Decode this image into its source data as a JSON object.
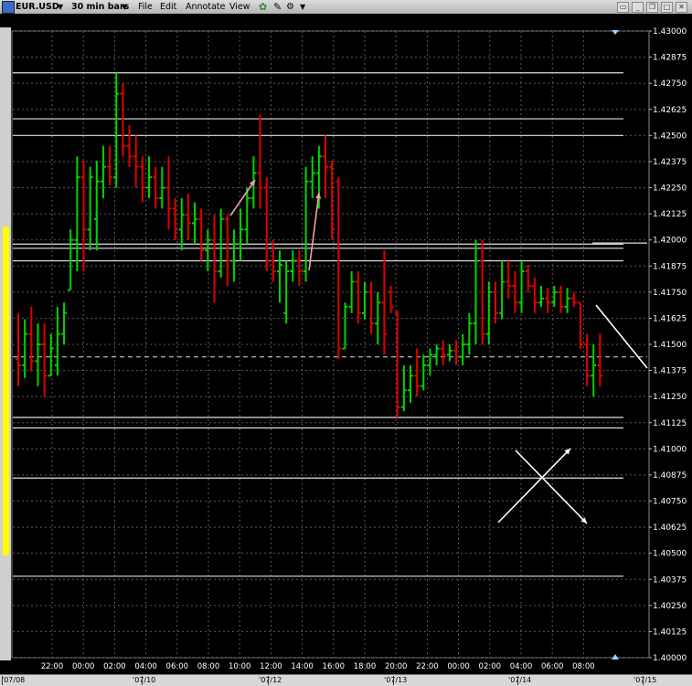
{
  "toolbar": {
    "symbol": "EUR.USD",
    "bar_size": "30 min bars",
    "menu": [
      "File",
      "Edit",
      "Annotate",
      "View"
    ]
  },
  "chart_data": {
    "type": "candlestick",
    "y_ticks": [
      "1.43000",
      "1.42875",
      "1.42750",
      "1.42625",
      "1.42500",
      "1.42375",
      "1.42250",
      "1.42125",
      "1.42000",
      "1.41875",
      "1.41750",
      "1.41625",
      "1.41500",
      "1.41375",
      "1.41250",
      "1.41125",
      "1.41000",
      "1.40875",
      "1.40750",
      "1.40625",
      "1.40500",
      "1.40375",
      "1.40250",
      "1.40125",
      "1.40000"
    ],
    "ylim": [
      1.4,
      1.43
    ],
    "time_ticks": [
      "22:00",
      "00:00",
      "02:00",
      "04:00",
      "06:00",
      "08:00",
      "10:00",
      "12:00",
      "14:00",
      "16:00",
      "18:00",
      "20:00",
      "22:00",
      "00:00",
      "02:00",
      "04:00",
      "06:00",
      "08:00"
    ],
    "date_ticks": [
      "'07/08",
      "'07/10",
      "'07/12",
      "'07/13",
      "'07/14",
      "'07/15"
    ],
    "grid": true,
    "horizontal_lines": [
      1.428,
      1.4258,
      1.425,
      1.4198,
      1.4196,
      1.419,
      1.4115,
      1.411,
      1.4086,
      1.4039
    ],
    "dashed_level": 1.4144,
    "candles": [
      {
        "o": 1.4143,
        "h": 1.4165,
        "l": 1.413,
        "c": 1.414
      },
      {
        "o": 1.414,
        "h": 1.4162,
        "l": 1.4134,
        "c": 1.4155
      },
      {
        "o": 1.4155,
        "h": 1.4168,
        "l": 1.4137,
        "c": 1.4142
      },
      {
        "o": 1.4142,
        "h": 1.416,
        "l": 1.413,
        "c": 1.415
      },
      {
        "o": 1.415,
        "h": 1.416,
        "l": 1.4125,
        "c": 1.4135
      },
      {
        "o": 1.4135,
        "h": 1.4155,
        "l": 1.4135,
        "c": 1.4148
      },
      {
        "o": 1.414,
        "h": 1.4168,
        "l": 1.4135,
        "c": 1.4155
      },
      {
        "o": 1.4155,
        "h": 1.417,
        "l": 1.415,
        "c": 1.4165
      },
      {
        "o": 1.4176,
        "h": 1.4205,
        "l": 1.4176,
        "c": 1.42
      },
      {
        "o": 1.42,
        "h": 1.424,
        "l": 1.4185,
        "c": 1.423
      },
      {
        "o": 1.423,
        "h": 1.4238,
        "l": 1.4185,
        "c": 1.4205
      },
      {
        "o": 1.4205,
        "h": 1.4235,
        "l": 1.4195,
        "c": 1.423
      },
      {
        "o": 1.421,
        "h": 1.4238,
        "l": 1.4195,
        "c": 1.4228
      },
      {
        "o": 1.4228,
        "h": 1.4245,
        "l": 1.422,
        "c": 1.4235
      },
      {
        "o": 1.4235,
        "h": 1.4245,
        "l": 1.4226,
        "c": 1.423
      },
      {
        "o": 1.423,
        "h": 1.428,
        "l": 1.4225,
        "c": 1.427
      },
      {
        "o": 1.427,
        "h": 1.4275,
        "l": 1.424,
        "c": 1.4245
      },
      {
        "o": 1.4245,
        "h": 1.4255,
        "l": 1.4235,
        "c": 1.424
      },
      {
        "o": 1.424,
        "h": 1.425,
        "l": 1.4225,
        "c": 1.4235
      },
      {
        "o": 1.4235,
        "h": 1.424,
        "l": 1.4218,
        "c": 1.4225
      },
      {
        "o": 1.4225,
        "h": 1.424,
        "l": 1.422,
        "c": 1.423
      },
      {
        "o": 1.423,
        "h": 1.4235,
        "l": 1.4215,
        "c": 1.422
      },
      {
        "o": 1.422,
        "h": 1.4235,
        "l": 1.4215,
        "c": 1.4225
      },
      {
        "o": 1.4225,
        "h": 1.424,
        "l": 1.4205,
        "c": 1.4215
      },
      {
        "o": 1.4215,
        "h": 1.422,
        "l": 1.42,
        "c": 1.4205
      },
      {
        "o": 1.4205,
        "h": 1.422,
        "l": 1.4195,
        "c": 1.4212
      },
      {
        "o": 1.4212,
        "h": 1.4222,
        "l": 1.42,
        "c": 1.4208
      },
      {
        "o": 1.4208,
        "h": 1.4218,
        "l": 1.4198,
        "c": 1.421
      },
      {
        "o": 1.421,
        "h": 1.4215,
        "l": 1.419,
        "c": 1.4195
      },
      {
        "o": 1.4195,
        "h": 1.4205,
        "l": 1.4185,
        "c": 1.42
      },
      {
        "o": 1.42,
        "h": 1.4212,
        "l": 1.417,
        "c": 1.4185
      },
      {
        "o": 1.4185,
        "h": 1.4215,
        "l": 1.4182,
        "c": 1.421
      },
      {
        "o": 1.421,
        "h": 1.4212,
        "l": 1.4178,
        "c": 1.419
      },
      {
        "o": 1.419,
        "h": 1.4205,
        "l": 1.418,
        "c": 1.4198
      },
      {
        "o": 1.4198,
        "h": 1.4215,
        "l": 1.419,
        "c": 1.4205
      },
      {
        "o": 1.4205,
        "h": 1.4225,
        "l": 1.4198,
        "c": 1.422
      },
      {
        "o": 1.422,
        "h": 1.424,
        "l": 1.4215,
        "c": 1.4232
      },
      {
        "o": 1.4232,
        "h": 1.426,
        "l": 1.4215,
        "c": 1.4225
      },
      {
        "o": 1.4225,
        "h": 1.423,
        "l": 1.4185,
        "c": 1.419
      },
      {
        "o": 1.419,
        "h": 1.42,
        "l": 1.418,
        "c": 1.4185
      },
      {
        "o": 1.4185,
        "h": 1.4195,
        "l": 1.417,
        "c": 1.4188
      },
      {
        "o": 1.4165,
        "h": 1.419,
        "l": 1.416,
        "c": 1.4185
      },
      {
        "o": 1.4185,
        "h": 1.4195,
        "l": 1.418,
        "c": 1.419
      },
      {
        "o": 1.419,
        "h": 1.4195,
        "l": 1.4178,
        "c": 1.4185
      },
      {
        "o": 1.4185,
        "h": 1.4235,
        "l": 1.418,
        "c": 1.4228
      },
      {
        "o": 1.4228,
        "h": 1.424,
        "l": 1.422,
        "c": 1.4232
      },
      {
        "o": 1.4232,
        "h": 1.4245,
        "l": 1.4215,
        "c": 1.424
      },
      {
        "o": 1.424,
        "h": 1.425,
        "l": 1.422,
        "c": 1.4235
      },
      {
        "o": 1.4235,
        "h": 1.4238,
        "l": 1.42,
        "c": 1.4205
      },
      {
        "o": 1.4228,
        "h": 1.423,
        "l": 1.4143,
        "c": 1.4148
      },
      {
        "o": 1.4148,
        "h": 1.417,
        "l": 1.4148,
        "c": 1.4168
      },
      {
        "o": 1.4168,
        "h": 1.4185,
        "l": 1.4165,
        "c": 1.418
      },
      {
        "o": 1.418,
        "h": 1.4185,
        "l": 1.416,
        "c": 1.4165
      },
      {
        "o": 1.4165,
        "h": 1.418,
        "l": 1.4162,
        "c": 1.4175
      },
      {
        "o": 1.4175,
        "h": 1.418,
        "l": 1.4155,
        "c": 1.416
      },
      {
        "o": 1.416,
        "h": 1.4175,
        "l": 1.415,
        "c": 1.417
      },
      {
        "o": 1.417,
        "h": 1.4195,
        "l": 1.4145,
        "c": 1.4155
      },
      {
        "o": 1.4175,
        "h": 1.4178,
        "l": 1.4165,
        "c": 1.4168
      },
      {
        "o": 1.4165,
        "h": 1.4166,
        "l": 1.4115,
        "c": 1.412
      },
      {
        "o": 1.412,
        "h": 1.414,
        "l": 1.4118,
        "c": 1.4128
      },
      {
        "o": 1.4128,
        "h": 1.414,
        "l": 1.4122,
        "c": 1.4135
      },
      {
        "o": 1.4135,
        "h": 1.4148,
        "l": 1.4125,
        "c": 1.413
      },
      {
        "o": 1.413,
        "h": 1.4145,
        "l": 1.4128,
        "c": 1.414
      },
      {
        "o": 1.414,
        "h": 1.4148,
        "l": 1.4135,
        "c": 1.4145
      },
      {
        "o": 1.4145,
        "h": 1.415,
        "l": 1.414,
        "c": 1.4148
      },
      {
        "o": 1.4148,
        "h": 1.4152,
        "l": 1.414,
        "c": 1.4145
      },
      {
        "o": 1.4145,
        "h": 1.415,
        "l": 1.4142,
        "c": 1.4147
      },
      {
        "o": 1.4147,
        "h": 1.4152,
        "l": 1.414,
        "c": 1.4144
      },
      {
        "o": 1.4144,
        "h": 1.4155,
        "l": 1.414,
        "c": 1.415
      },
      {
        "o": 1.415,
        "h": 1.4165,
        "l": 1.4145,
        "c": 1.416
      },
      {
        "o": 1.416,
        "h": 1.42,
        "l": 1.415,
        "c": 1.419
      },
      {
        "o": 1.419,
        "h": 1.42,
        "l": 1.415,
        "c": 1.4155
      },
      {
        "o": 1.4155,
        "h": 1.418,
        "l": 1.415,
        "c": 1.4175
      },
      {
        "o": 1.4175,
        "h": 1.418,
        "l": 1.416,
        "c": 1.4165
      },
      {
        "o": 1.4165,
        "h": 1.419,
        "l": 1.4162,
        "c": 1.418
      },
      {
        "o": 1.418,
        "h": 1.419,
        "l": 1.4172,
        "c": 1.4178
      },
      {
        "o": 1.4178,
        "h": 1.4185,
        "l": 1.4165,
        "c": 1.417
      },
      {
        "o": 1.417,
        "h": 1.419,
        "l": 1.4165,
        "c": 1.4185
      },
      {
        "o": 1.4185,
        "h": 1.4188,
        "l": 1.4175,
        "c": 1.4178
      },
      {
        "o": 1.4178,
        "h": 1.4182,
        "l": 1.4165,
        "c": 1.417
      },
      {
        "o": 1.417,
        "h": 1.4178,
        "l": 1.4168,
        "c": 1.4172
      },
      {
        "o": 1.4172,
        "h": 1.4177,
        "l": 1.4165,
        "c": 1.417
      },
      {
        "o": 1.417,
        "h": 1.4178,
        "l": 1.4168,
        "c": 1.4175
      },
      {
        "o": 1.4175,
        "h": 1.4178,
        "l": 1.4165,
        "c": 1.4168
      },
      {
        "o": 1.4168,
        "h": 1.4177,
        "l": 1.4165,
        "c": 1.4172
      },
      {
        "o": 1.4172,
        "h": 1.4175,
        "l": 1.4168,
        "c": 1.417
      },
      {
        "o": 1.417,
        "h": 1.417,
        "l": 1.4148,
        "c": 1.415
      },
      {
        "o": 1.415,
        "h": 1.4155,
        "l": 1.413,
        "c": 1.4135
      },
      {
        "o": 1.4135,
        "h": 1.415,
        "l": 1.4125,
        "c": 1.414
      },
      {
        "o": 1.414,
        "h": 1.4155,
        "l": 1.413,
        "c": 1.4135
      }
    ]
  },
  "colors": {
    "up": "#00d400",
    "down": "#e00000",
    "doji": "#ffee00",
    "grid": "#5a5a5a",
    "hline": "#e0e0e0",
    "accent_bar": "#ffff00"
  }
}
